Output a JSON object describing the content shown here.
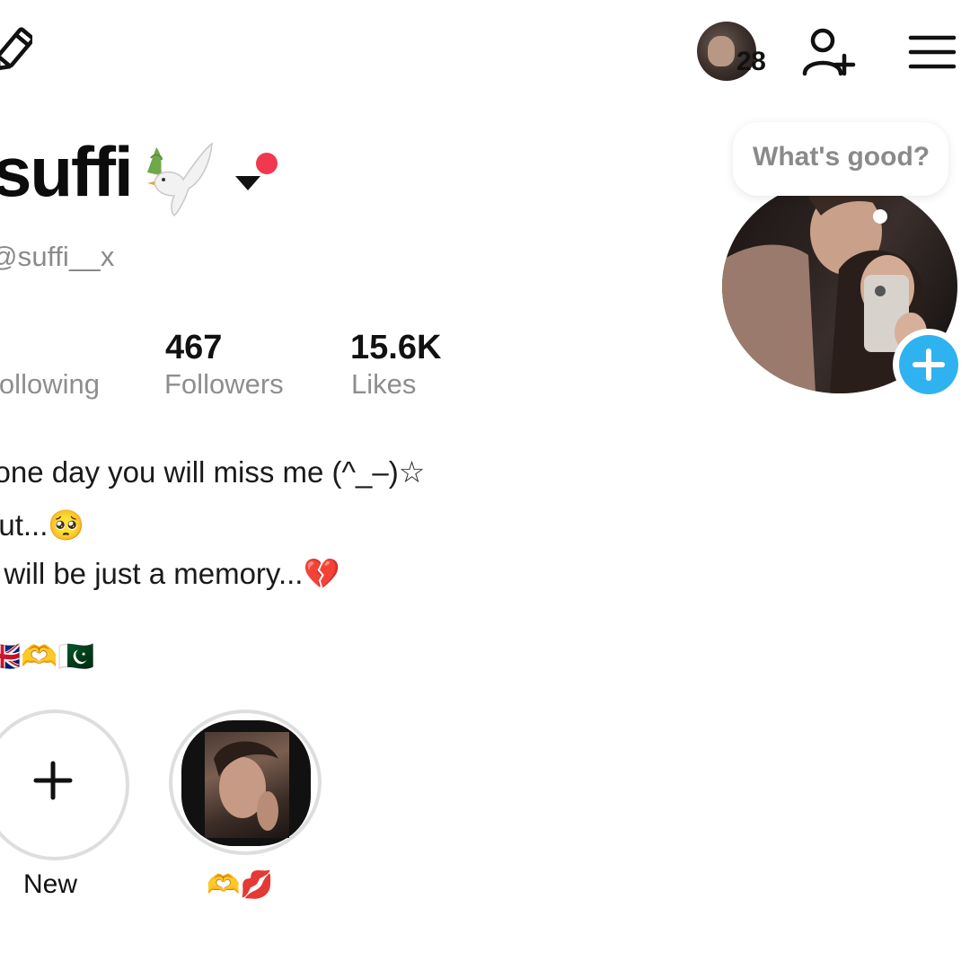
{
  "header": {
    "visitor_count": "28"
  },
  "profile": {
    "display_name": "suffi",
    "username": "@suffi__x",
    "stats": [
      {
        "value": "",
        "label": "Following"
      },
      {
        "value": "467",
        "label": "Followers"
      },
      {
        "value": "15.6K",
        "label": "Likes"
      }
    ],
    "bio_lines": [
      "•one day you will miss me (^_–)☆",
      "but...🥺",
      "I will be just a memory...💔",
      "🇬🇧🫶🇵🇰"
    ],
    "photo_tooltip": "What's good?"
  },
  "stories": [
    {
      "label": "New"
    },
    {
      "label": "🫶💋"
    }
  ],
  "colors": {
    "notification_dot": "#f0384f",
    "add_button": "#2fb3f0",
    "muted_text": "#8a8a8a"
  },
  "icons": {
    "edit": "pencil-icon",
    "add_friend": "add-user-icon",
    "menu": "hamburger-menu-icon",
    "name_decoration": "dove-icon",
    "dropdown": "caret-down-icon",
    "add_photo": "plus-icon"
  }
}
